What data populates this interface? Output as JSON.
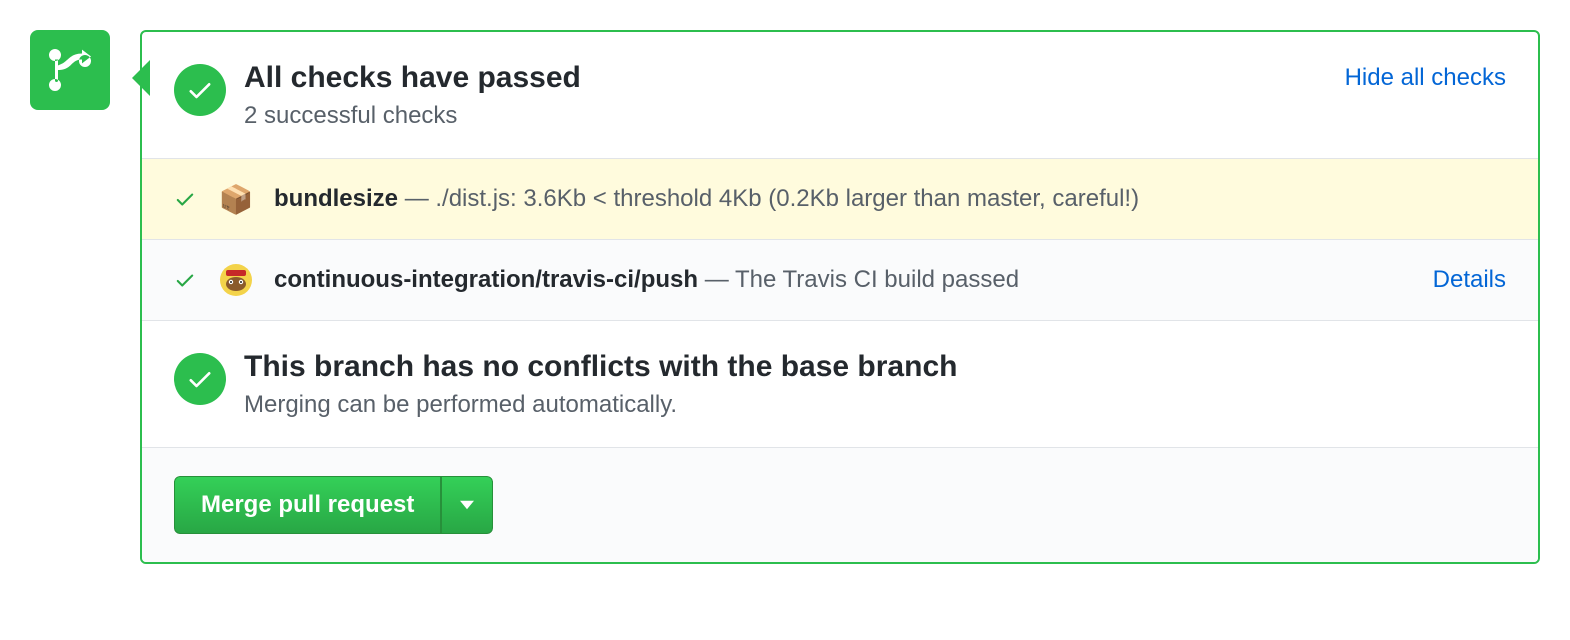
{
  "colors": {
    "success": "#2cbe4e",
    "link": "#0366d6",
    "highlight_bg": "#fffbdd",
    "muted": "#586069"
  },
  "icons": {
    "timeline": "git-merge-icon"
  },
  "checks_summary": {
    "title": "All checks have passed",
    "subtitle": "2 successful checks",
    "toggle_link": "Hide all checks"
  },
  "checks": [
    {
      "status": "success",
      "avatar_emoji": "📦",
      "name": "bundlesize",
      "separator": " — ",
      "description": "./dist.js: 3.6Kb < threshold 4Kb (0.2Kb larger than master, careful!)",
      "details_link": "",
      "highlight": true
    },
    {
      "status": "success",
      "avatar_emoji": "🧑‍🔧",
      "name": "continuous-integration/travis-ci/push",
      "separator": " — ",
      "description": "The Travis CI build passed",
      "details_link": "Details",
      "highlight": false
    }
  ],
  "merge_status": {
    "title": "This branch has no conflicts with the base branch",
    "subtitle": "Merging can be performed automatically."
  },
  "merge_button": {
    "label": "Merge pull request"
  }
}
